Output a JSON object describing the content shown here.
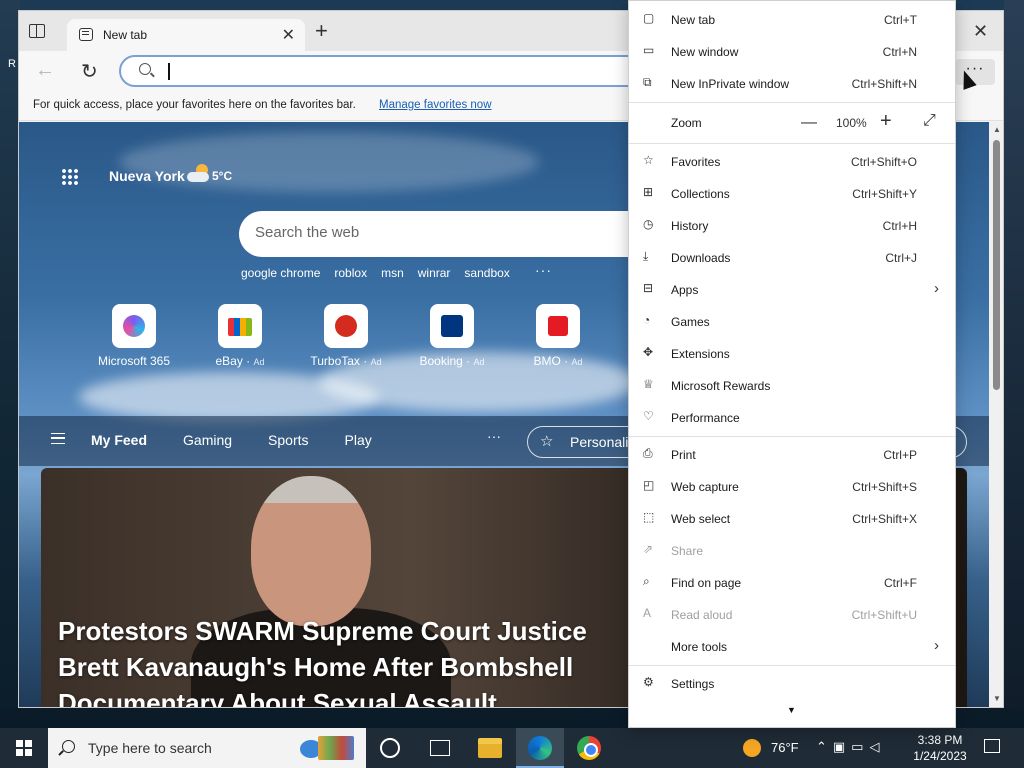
{
  "tab": {
    "title": "New tab",
    "close": "✕",
    "new": "+"
  },
  "window": {
    "close": "✕"
  },
  "toolbar": {
    "back": "←",
    "reload": "↻",
    "more": "···",
    "address_value": ""
  },
  "favorites_bar": {
    "text": "For quick access, place your favorites here on the favorites bar.",
    "link": "Manage favorites now"
  },
  "ntp": {
    "city": "Nueva York",
    "temp": "5°C",
    "search_placeholder": "Search the web",
    "quick_links": [
      "google chrome",
      "roblox",
      "msn",
      "winrar",
      "sandbox"
    ],
    "quick_links_more": "···",
    "tiles": [
      {
        "name": "Microsoft 365",
        "ad": ""
      },
      {
        "name": "eBay",
        "ad": "Ad"
      },
      {
        "name": "TurboTax",
        "ad": "Ad"
      },
      {
        "name": "Booking",
        "ad": "Ad"
      },
      {
        "name": "BMO",
        "ad": "Ad"
      }
    ],
    "feed_nav": [
      "My Feed",
      "Gaming",
      "Sports",
      "Play"
    ],
    "feed_more": "···",
    "personalize": "Personalize",
    "headline": "Protestors SWARM Supreme Court Justice Brett Kavanaugh's Home After Bombshell Documentary About Sexual Assault..."
  },
  "menu": {
    "items": [
      {
        "label": "New tab",
        "shortcut": "Ctrl+T",
        "icon": "new-tab-icon"
      },
      {
        "label": "New window",
        "shortcut": "Ctrl+N",
        "icon": "new-window-icon"
      },
      {
        "label": "New InPrivate window",
        "shortcut": "Ctrl+Shift+N",
        "icon": "inprivate-icon"
      },
      {
        "label": "Favorites",
        "shortcut": "Ctrl+Shift+O",
        "icon": "favorites-icon"
      },
      {
        "label": "Collections",
        "shortcut": "Ctrl+Shift+Y",
        "icon": "collections-icon"
      },
      {
        "label": "History",
        "shortcut": "Ctrl+H",
        "icon": "history-icon"
      },
      {
        "label": "Downloads",
        "shortcut": "Ctrl+J",
        "icon": "downloads-icon"
      },
      {
        "label": "Apps",
        "shortcut": "",
        "icon": "apps-icon"
      },
      {
        "label": "Games",
        "shortcut": "",
        "icon": "games-icon"
      },
      {
        "label": "Extensions",
        "shortcut": "",
        "icon": "extensions-icon"
      },
      {
        "label": "Microsoft Rewards",
        "shortcut": "",
        "icon": "rewards-icon"
      },
      {
        "label": "Performance",
        "shortcut": "",
        "icon": "performance-icon"
      },
      {
        "label": "Print",
        "shortcut": "Ctrl+P",
        "icon": "print-icon"
      },
      {
        "label": "Web capture",
        "shortcut": "Ctrl+Shift+S",
        "icon": "web-capture-icon"
      },
      {
        "label": "Web select",
        "shortcut": "Ctrl+Shift+X",
        "icon": "web-select-icon"
      },
      {
        "label": "Share",
        "shortcut": "",
        "icon": "share-icon"
      },
      {
        "label": "Find on page",
        "shortcut": "Ctrl+F",
        "icon": "find-icon"
      },
      {
        "label": "Read aloud",
        "shortcut": "Ctrl+Shift+U",
        "icon": "read-aloud-icon"
      },
      {
        "label": "More tools",
        "shortcut": "",
        "icon": "more-tools-icon"
      },
      {
        "label": "Settings",
        "shortcut": "",
        "icon": "settings-icon"
      }
    ],
    "zoom_label": "Zoom",
    "zoom_value": "100%",
    "zoom_minus": "—",
    "zoom_plus": "+",
    "zoom_full": "⤢",
    "arrow": "›",
    "scroll_more": "▼"
  },
  "taskbar": {
    "search_placeholder": "Type here to search",
    "temp": "76°F",
    "time": "3:38 PM",
    "date": "1/24/2023"
  }
}
